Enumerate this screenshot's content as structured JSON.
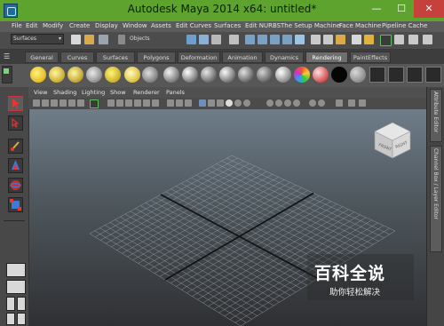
{
  "window": {
    "title": "Autodesk Maya 2014 x64: untitled*",
    "minimize_glyph": "—",
    "maximize_glyph": "☐",
    "close_glyph": "✕",
    "titlebar_color": "#5fa32f"
  },
  "menubar": {
    "items": [
      "File",
      "Edit",
      "Modify",
      "Create",
      "Display",
      "Window",
      "Assets",
      "Edit Curves",
      "Surfaces",
      "Edit NURBS",
      "The Setup Machine",
      "Face Machine",
      "Pipeline Cache"
    ]
  },
  "statusline": {
    "mode": "Surfaces",
    "objects_label": "Objects"
  },
  "shelf": {
    "tabs": [
      "General",
      "Curves",
      "Surfaces",
      "Polygons",
      "Deformation",
      "Animation",
      "Dynamics",
      "Rendering",
      "PaintEffects"
    ],
    "active_tab": "Rendering"
  },
  "viewport": {
    "menu": [
      "View",
      "Shading",
      "Lighting",
      "Show",
      "Renderer",
      "Panels"
    ],
    "viewcube": {
      "front": "FRONT",
      "right": "RIGHT"
    }
  },
  "right_panel": {
    "tabs": [
      "Attribute Editor",
      "Channel Box / Layer Editor"
    ]
  },
  "watermark": {
    "main": "百科全说",
    "sub": "助你轻松解决"
  }
}
